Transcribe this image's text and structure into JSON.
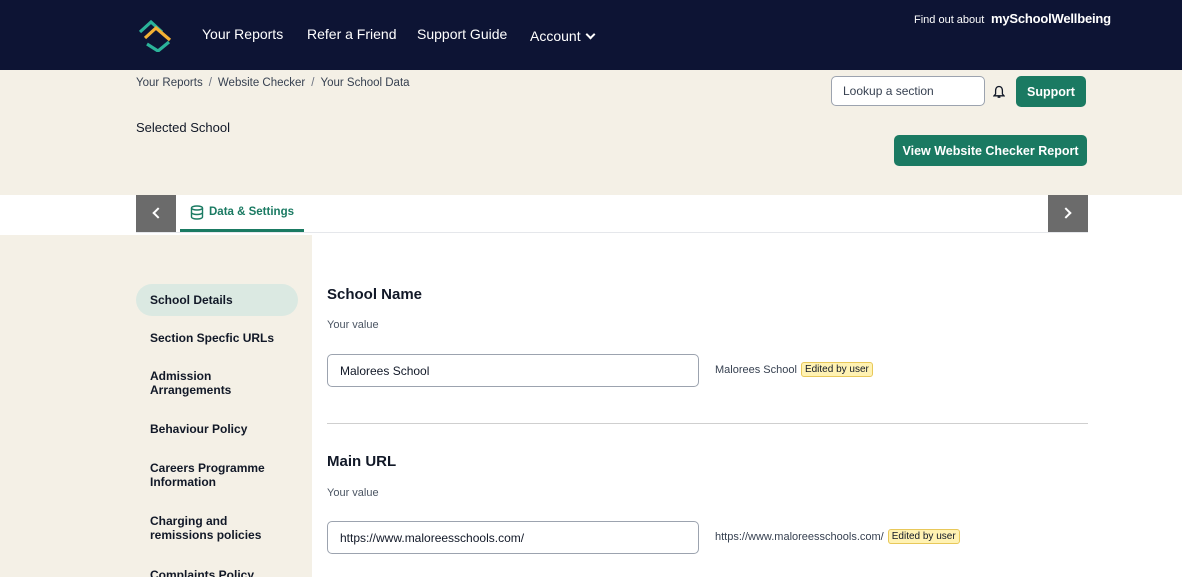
{
  "nav": {
    "items": [
      "Your Reports",
      "Refer a Friend",
      "Support Guide"
    ],
    "account_label": "Account",
    "findout_label": "Find out about",
    "brand_label": "mySchoolWellbeing"
  },
  "breadcrumb": [
    "Your Reports",
    "Website Checker",
    "Your School Data"
  ],
  "header": {
    "search_placeholder": "Lookup a section",
    "support_label": "Support",
    "selected_school_label": "Selected School",
    "report_button_label": "View Website Checker Report"
  },
  "tabs": {
    "active_label": "Data & Settings"
  },
  "sidebar": {
    "items": [
      "School Details",
      "Section Specfic URLs",
      "Admission Arrangements",
      "Behaviour Policy",
      "Careers Programme Information",
      "Charging and remissions policies",
      "Complaints Policy"
    ],
    "active_index": 0
  },
  "sections": [
    {
      "title": "School Name",
      "hint": "Your value",
      "value": "Malorees School",
      "current_value": "Malorees School",
      "badge": "Edited by user"
    },
    {
      "title": "Main URL",
      "hint": "Your value",
      "value": "https://www.maloreesschools.com/",
      "current_value": "https://www.maloreesschools.com/",
      "badge": "Edited by user"
    }
  ],
  "colors": {
    "nav_bg": "#0d1434",
    "header_bg": "#f4f0e6",
    "accent": "#1a7a62",
    "badge_bg": "#fff2b3"
  }
}
